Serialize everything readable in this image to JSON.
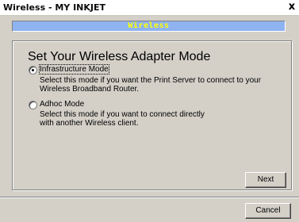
{
  "window": {
    "title": "Wireless - MY INKJET",
    "close_glyph": "x"
  },
  "banner": {
    "text": "Wireless"
  },
  "main": {
    "heading": "Set Your Wireless Adapter Mode",
    "options": [
      {
        "label": "Infrastructure Mode",
        "description_line1": "Select this mode if you want the Print Server to connect to your",
        "description_line2": "Wireless Broadband Router.",
        "selected": true
      },
      {
        "label": "Adhoc Mode",
        "description_line1": "Select this mode if you want to connect directly",
        "description_line2": "with another Wireless client.",
        "selected": false
      }
    ]
  },
  "buttons": {
    "next_label": "Next",
    "cancel_label": "Cancel"
  },
  "colors": {
    "banner_bg": "#8fb3f0",
    "banner_text": "#ffff00",
    "window_bg": "#d4d0c8"
  }
}
